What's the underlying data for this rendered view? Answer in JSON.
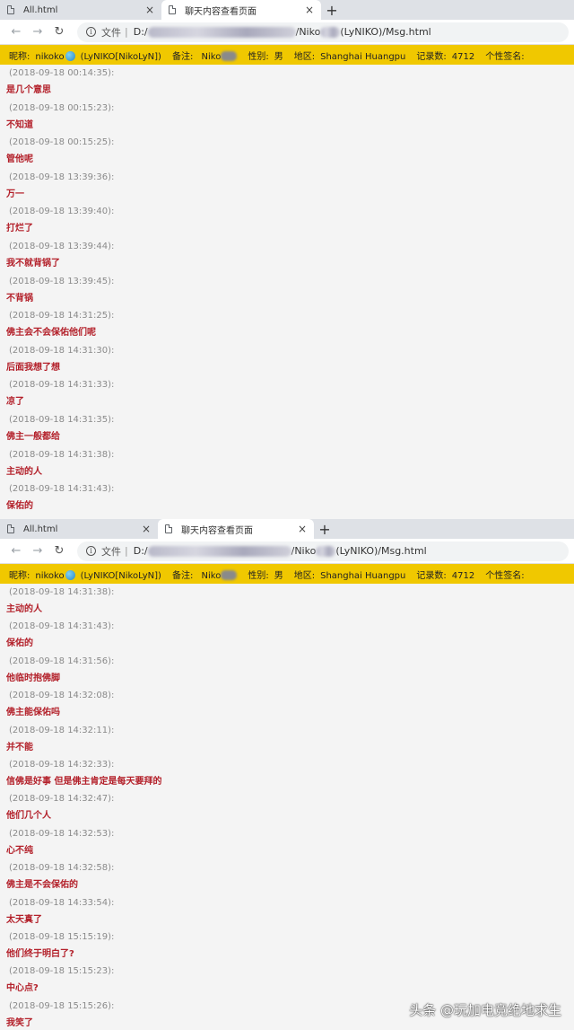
{
  "tabs": {
    "inactive_label": "All.html",
    "active_label": "聊天内容查看页面",
    "close_glyph": "×",
    "newtab_glyph": "+"
  },
  "address": {
    "info_glyph": "i",
    "scheme_label": "文件",
    "separator": "|",
    "url_prefix": "D:/",
    "url_mid": "/Niko",
    "url_suffix": "(LyNIKO)/Msg.html"
  },
  "info_bar": {
    "nickname_label": "昵称:",
    "nickname_prefix": "nikoko",
    "nickname_suffix": "(LyNIKO[NikoLyN])",
    "remark_label": "备注:",
    "remark_value": "Niko",
    "gender_label": "性别:",
    "gender_value": "男",
    "region_label": "地区:",
    "region_value": "Shanghai Huangpu",
    "records_label": "记录数:",
    "records_value": "4712",
    "signature_label": "个性签名:"
  },
  "log1": [
    {
      "ts": "(2018-09-18 00:14:35):",
      "text": "是几个意思"
    },
    {
      "ts": "(2018-09-18 00:15:23):",
      "text": "不知道"
    },
    {
      "ts": "(2018-09-18 00:15:25):",
      "text": "管他呢"
    },
    {
      "ts": "(2018-09-18 13:39:36):",
      "text": "万一"
    },
    {
      "ts": "(2018-09-18 13:39:40):",
      "text": "打烂了"
    },
    {
      "ts": "(2018-09-18 13:39:44):",
      "text": "我不就背锅了"
    },
    {
      "ts": "(2018-09-18 13:39:45):",
      "text": "不背锅"
    },
    {
      "ts": "(2018-09-18 14:31:25):",
      "text": "佛主会不会保佑他们呢"
    },
    {
      "ts": "(2018-09-18 14:31:30):",
      "text": "后面我想了想"
    },
    {
      "ts": "(2018-09-18 14:31:33):",
      "text": "凉了"
    },
    {
      "ts": "(2018-09-18 14:31:35):",
      "text": "佛主一般都给"
    },
    {
      "ts": "(2018-09-18 14:31:38):",
      "text": "主动的人"
    },
    {
      "ts": "(2018-09-18 14:31:43):",
      "text": "保佑的"
    }
  ],
  "log2": [
    {
      "ts": "(2018-09-18 14:31:38):",
      "text": "主动的人"
    },
    {
      "ts": "(2018-09-18 14:31:43):",
      "text": "保佑的"
    },
    {
      "ts": "(2018-09-18 14:31:56):",
      "text": "他临时抱佛脚"
    },
    {
      "ts": "(2018-09-18 14:32:08):",
      "text": "佛主能保佑吗"
    },
    {
      "ts": "(2018-09-18 14:32:11):",
      "text": "并不能"
    },
    {
      "ts": "(2018-09-18 14:32:33):",
      "text": "信佛是好事 但是佛主肯定是每天要拜的"
    },
    {
      "ts": "(2018-09-18 14:32:47):",
      "text": "他们几个人"
    },
    {
      "ts": "(2018-09-18 14:32:53):",
      "text": "心不纯"
    },
    {
      "ts": "(2018-09-18 14:32:58):",
      "text": "佛主是不会保佑的"
    },
    {
      "ts": "(2018-09-18 14:33:54):",
      "text": "太天真了"
    },
    {
      "ts": "(2018-09-18 15:15:19):",
      "text": "他们终于明白了?"
    },
    {
      "ts": "(2018-09-18 15:15:23):",
      "text": "中心点?"
    },
    {
      "ts": "(2018-09-18 15:15:26):",
      "text": "我笑了"
    }
  ],
  "watermark": "头条 @玩加电竞绝地求生"
}
